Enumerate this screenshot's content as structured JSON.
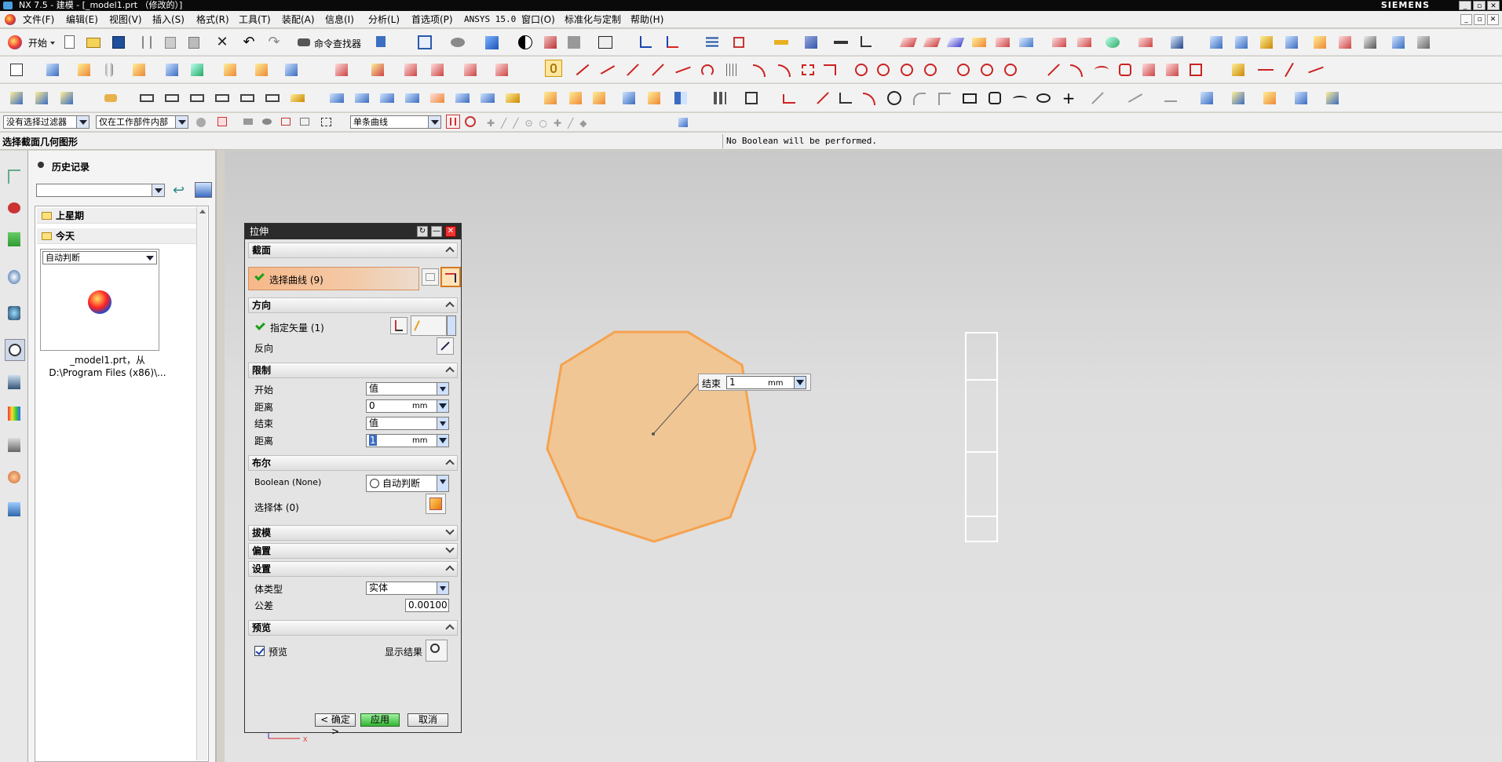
{
  "window": {
    "title": "NX 7.5 - 建模 - [_model1.prt （修改的）]",
    "brand": "SIEMENS"
  },
  "menu": [
    "文件(F)",
    "编辑(E)",
    "视图(V)",
    "插入(S)",
    "格式(R)",
    "工具(T)",
    "装配(A)",
    "信息(I)",
    "分析(L)",
    "首选项(P)",
    "ANSYS 15.0",
    "窗口(O)",
    "标准化与定制",
    "帮助(H)"
  ],
  "toolbar": {
    "start_label": "开始",
    "command_finder_label": "命令查找器"
  },
  "selection_bar": {
    "filter": "没有选择过滤器",
    "scope": "仅在工作部件内部",
    "curve_rule": "单条曲线"
  },
  "cue_line": {
    "prompt": "选择截面几何图形",
    "status": "No Boolean will be performed."
  },
  "history": {
    "title": "历史记录",
    "groups": [
      "上星期",
      "今天"
    ],
    "thumb_combo": "自动判断",
    "file_caption_1": "_model1.prt，从",
    "file_caption_2": "D:\\Program Files (x86)\\..."
  },
  "dialog": {
    "title": "拉伸",
    "section": {
      "header": "截面",
      "select_curve": "选择曲线 (9)"
    },
    "direction": {
      "header": "方向",
      "specify_vector": "指定矢量 (1)",
      "reverse": "反向"
    },
    "limits": {
      "header": "限制",
      "start_label": "开始",
      "start_option": "值",
      "start_distance_label": "距离",
      "start_distance": "0",
      "end_label": "结束",
      "end_option": "值",
      "end_distance_label": "距离",
      "end_distance": "1",
      "unit": "mm"
    },
    "boolean": {
      "header": "布尔",
      "label": "Boolean (None)",
      "option": "自动判断",
      "select_body": "选择体 (0)"
    },
    "draft": {
      "header": "拔模"
    },
    "offset": {
      "header": "偏置"
    },
    "settings": {
      "header": "设置",
      "body_type_label": "体类型",
      "body_type": "实体",
      "tolerance_label": "公差",
      "tolerance": "0.00100"
    },
    "preview": {
      "header": "预览",
      "checkbox_label": "预览",
      "show_result": "显示结果"
    },
    "buttons": {
      "ok": "< 确定 >",
      "apply": "应用",
      "cancel": "取消"
    }
  },
  "end_popup": {
    "label": "结束",
    "value": "1",
    "unit": "mm"
  },
  "axis_label": "X",
  "colors": {
    "shape_fill": "#f3c38d",
    "shape_stroke": "#f5a24e",
    "selection_highlight": "#f7b88a",
    "apply_green": "#32b532"
  }
}
